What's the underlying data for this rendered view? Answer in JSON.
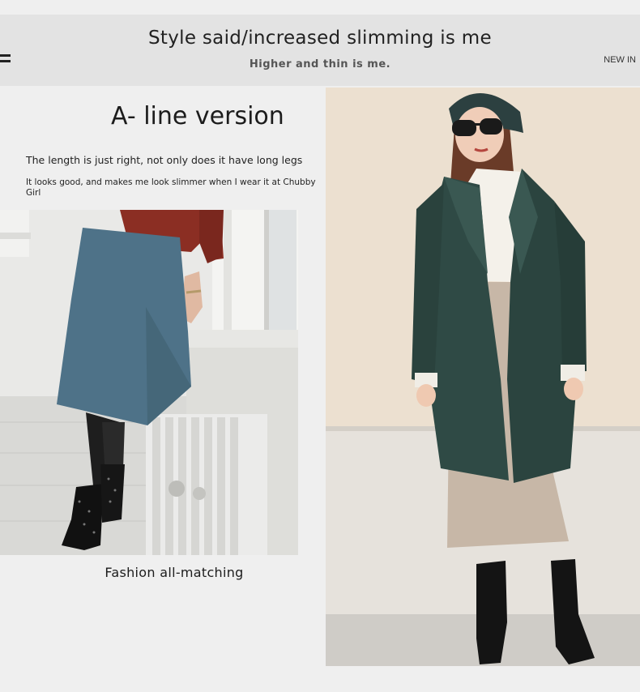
{
  "banner": {
    "title": "Style said/increased slimming is me",
    "subtitle": "Higher and thin is me.",
    "tag": "NEW IN"
  },
  "section": {
    "headline": "A- line version",
    "line1": "The length is just right, not only does it have long legs",
    "line2": "It looks good, and makes me look slimmer when I wear it at Chubby Girl"
  },
  "photo_left": {
    "caption": "Fashion all-matching",
    "icon": "photo-blue-pencil-skirt-by-window"
  },
  "photo_right": {
    "icon": "photo-green-coat-and-beret"
  },
  "colors": {
    "background": "#efefef",
    "banner": "#e3e3e3",
    "coat": "#2f4a45",
    "skirt_blue": "#4e7288",
    "skirt_beige": "#c7b7a7",
    "sweater": "#8b2e23"
  }
}
